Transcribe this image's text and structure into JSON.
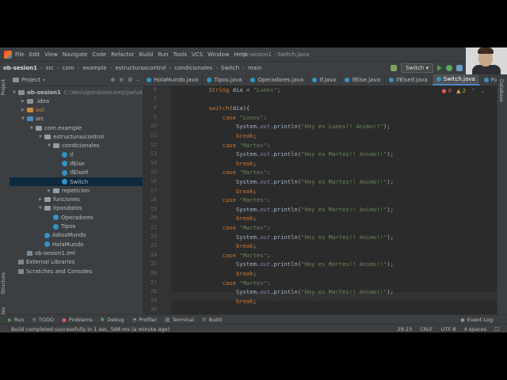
{
  "menubar": {
    "items": [
      "File",
      "Edit",
      "View",
      "Navigate",
      "Code",
      "Refactor",
      "Build",
      "Run",
      "Tools",
      "VCS",
      "Window",
      "Help"
    ],
    "title": "ob-sesion1 - Switch.java"
  },
  "navbar": {
    "crumbs": [
      "ob-sesion1",
      "src",
      "com",
      "example",
      "estructurascontrol",
      "condicionales",
      "Switch",
      "main"
    ],
    "run_config": "Switch"
  },
  "sidebar_left": {
    "project": "Project",
    "structure": "Structure",
    "favorites": "Favorites"
  },
  "sidebar_right": {
    "database": "Database"
  },
  "project_panel": {
    "title": "Project",
    "tree": [
      {
        "label": "ob-sesion1",
        "extra": "C:\\dev\\openbootcamp\\jse\\ob-sesion1",
        "depth": 0,
        "kind": "module",
        "open": true
      },
      {
        "label": ".idea",
        "depth": 1,
        "kind": "folder",
        "open": false
      },
      {
        "label": "out",
        "depth": 1,
        "kind": "folder-orange",
        "open": false
      },
      {
        "label": "src",
        "depth": 1,
        "kind": "folder-blue",
        "open": true
      },
      {
        "label": "com.example",
        "depth": 2,
        "kind": "package",
        "open": true
      },
      {
        "label": "estructurascontrol",
        "depth": 3,
        "kind": "package",
        "open": true
      },
      {
        "label": "condicionales",
        "depth": 4,
        "kind": "package",
        "open": true
      },
      {
        "label": "If",
        "depth": 5,
        "kind": "class"
      },
      {
        "label": "IfElse",
        "depth": 5,
        "kind": "class"
      },
      {
        "label": "IfElseIf",
        "depth": 5,
        "kind": "class"
      },
      {
        "label": "Switch",
        "depth": 5,
        "kind": "class",
        "selected": true
      },
      {
        "label": "repeticion",
        "depth": 4,
        "kind": "package",
        "open": false
      },
      {
        "label": "funciones",
        "depth": 3,
        "kind": "package",
        "open": false
      },
      {
        "label": "tiposdatos",
        "depth": 3,
        "kind": "package",
        "open": true
      },
      {
        "label": "Operadores",
        "depth": 4,
        "kind": "class"
      },
      {
        "label": "Tipos",
        "depth": 4,
        "kind": "class"
      },
      {
        "label": "AdiosMundo",
        "depth": 3,
        "kind": "class"
      },
      {
        "label": "HolaMundo",
        "depth": 3,
        "kind": "class"
      },
      {
        "label": "ob-sesion1.iml",
        "depth": 1,
        "kind": "file"
      },
      {
        "label": "External Libraries",
        "depth": 0,
        "kind": "lib"
      },
      {
        "label": "Scratches and Consoles",
        "depth": 0,
        "kind": "scratch"
      }
    ]
  },
  "tabs": [
    "HolaMundo.java",
    "Tipos.java",
    "Operadores.java",
    "If.java",
    "IfElse.java",
    "IfElseIf.java",
    "Switch.java",
    "Fur"
  ],
  "active_tab": "Switch.java",
  "inspections": {
    "errors": "6",
    "warnings": "2"
  },
  "editor": {
    "lines": [
      {
        "n": "6",
        "code": "    String dia = \"Lunes\";"
      },
      {
        "n": "7",
        "code": ""
      },
      {
        "n": "8",
        "code": "    switch(dia){"
      },
      {
        "n": "9",
        "code": "        case \"Lunes\":"
      },
      {
        "n": "10",
        "code": "            System.out.println(\"Hoy es Lunes!! Animo!!\");"
      },
      {
        "n": "11",
        "code": "            break;"
      },
      {
        "n": "12",
        "code": "        case \"Martes\":"
      },
      {
        "n": "13",
        "code": "            System.out.println(\"Hoy es Martes!! Animo!!\");"
      },
      {
        "n": "14",
        "code": "            break;"
      },
      {
        "n": "15",
        "code": "        case \"Martes\":"
      },
      {
        "n": "16",
        "code": "            System.out.println(\"Hoy es Martes!! Animo!!\");"
      },
      {
        "n": "17",
        "code": "            break;"
      },
      {
        "n": "18",
        "code": "        case \"Martes\":"
      },
      {
        "n": "19",
        "code": "            System.out.println(\"Hoy es Martes!! Animo!!\");"
      },
      {
        "n": "20",
        "code": "            break;"
      },
      {
        "n": "21",
        "code": "        case \"Martes\":"
      },
      {
        "n": "22",
        "code": "            System.out.println(\"Hoy es Martes!! Animo!!\");"
      },
      {
        "n": "23",
        "code": "            break;"
      },
      {
        "n": "24",
        "code": "        case \"Martes\":"
      },
      {
        "n": "25",
        "code": "            System.out.println(\"Hoy es Martes!! Animo!!\");"
      },
      {
        "n": "26",
        "code": "            break;"
      },
      {
        "n": "27",
        "code": "        case \"Martes\":"
      },
      {
        "n": "28",
        "code": "            System.out.println(\"Hoy es Martes!! Animo!!\");"
      },
      {
        "n": "29",
        "code": "            break;"
      },
      {
        "n": "30",
        "code": ""
      }
    ]
  },
  "tool_windows": [
    "Run",
    "TODO",
    "Problems",
    "Debug",
    "Profiler",
    "Terminal",
    "Build"
  ],
  "event_log": "Event Log",
  "status": {
    "message": "Build completed successfully in 1 sec, 588 ms (a minute ago)",
    "position": "29:23",
    "line_sep": "CRLF",
    "encoding": "UTF-8",
    "indent": "4 spaces"
  },
  "colors": {
    "keyword": "#cc7832",
    "string": "#6a8759",
    "field": "#9876aa",
    "default": "#a9b7c6"
  }
}
